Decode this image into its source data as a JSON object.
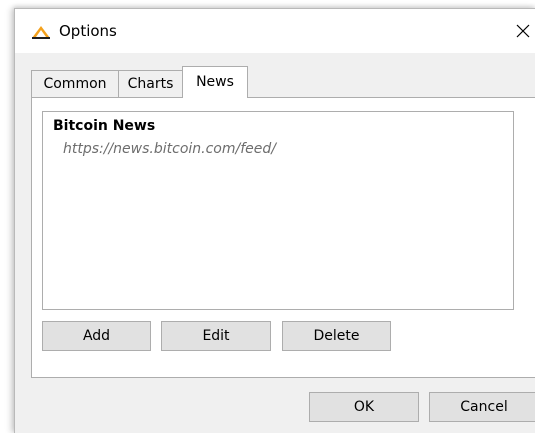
{
  "window": {
    "title": "Options",
    "close_glyph": "✕",
    "icon": "trading-app-icon"
  },
  "tabs": [
    {
      "label": "Common",
      "active": false
    },
    {
      "label": "Charts",
      "active": false
    },
    {
      "label": "News",
      "active": true
    }
  ],
  "feeds": [
    {
      "name": "Bitcoin News",
      "url": "https://news.bitcoin.com/feed/"
    }
  ],
  "actions": {
    "add": "Add",
    "edit": "Edit",
    "delete": "Delete"
  },
  "footer": {
    "ok": "OK",
    "cancel": "Cancel"
  },
  "colors": {
    "icon_orange": "#f4a11c",
    "icon_dark": "#1f1f1f"
  }
}
